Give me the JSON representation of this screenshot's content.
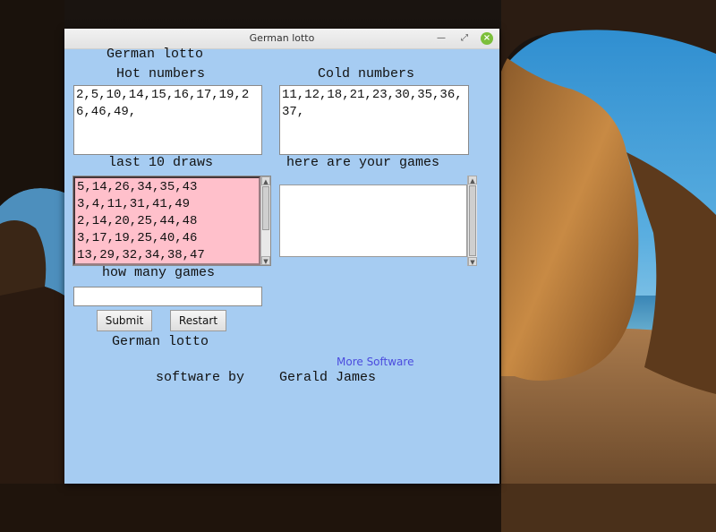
{
  "window": {
    "title": "German lotto"
  },
  "app": {
    "header": "German lotto",
    "hot_label": "Hot numbers",
    "cold_label": "Cold numbers",
    "hot_numbers": "2,5,10,14,15,16,17,19,26,46,49,",
    "cold_numbers": "11,12,18,21,23,30,35,36,37,",
    "draws_label": "last 10 draws",
    "games_label": "here are your games",
    "draws": [
      "5,14,26,34,35,43",
      "3,4,11,31,41,49",
      "2,14,20,25,44,48",
      "3,17,19,25,40,46",
      "13,29,32,34,38,47"
    ],
    "games": [],
    "how_many_label": "how many games",
    "how_many_value": "",
    "submit_label": "Submit",
    "restart_label": "Restart",
    "footer_title": "German lotto",
    "more_software_link": "More Software",
    "credit_prefix": "software by",
    "credit_name": "Gerald James"
  },
  "colors": {
    "window_bg": "#a6ccf2",
    "draws_bg": "#ffc0cb",
    "link": "#4b4bde"
  }
}
